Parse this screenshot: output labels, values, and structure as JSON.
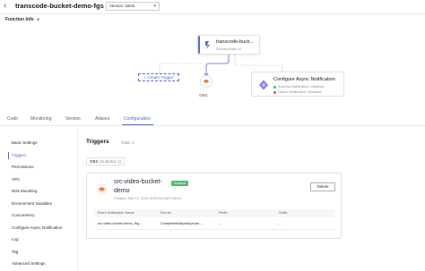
{
  "header": {
    "title": "transcode-bucket-demo-fgs",
    "version_label": "Version: latest"
  },
  "function_info_label": "Function Info",
  "diagram": {
    "function_name": "transcode-buck...",
    "function_sub": "FunctionGraph v2",
    "create_trigger": "+ Create Trigger",
    "obs_label": "OBS",
    "async": {
      "title": "Configure Async Notification",
      "success": "Success Notification: Disabled",
      "failure": "Failure Notification: Disabled"
    }
  },
  "tabs": [
    "Code",
    "Monitoring",
    "Version",
    "Aliases",
    "Configuration"
  ],
  "active_tab": "Configuration",
  "sidebar": {
    "items": [
      "Basic Settings",
      "Triggers",
      "Permissions",
      "VPC",
      "Disk Mounting",
      "Environment Variables",
      "Concurrency",
      "Configure Async Notification",
      "Log",
      "Tag",
      "Advanced Settings"
    ],
    "active": "Triggers"
  },
  "main": {
    "title": "Triggers",
    "total": "Total: 1",
    "section_label": "OBS",
    "section_count": "(Subtotal: 1)",
    "card": {
      "name": "src-video-bucket-demo",
      "status": "Enabled",
      "created": "Created: Mar 27, 2023 14:59:16 GMT+08:00",
      "delete_label": "Delete",
      "columns": [
        "Event Notification Name",
        "Events",
        "Prefix",
        "Suffix"
      ],
      "rows": [
        [
          "src-video-bucket-demo_fhg...",
          "CompleteMultipartUpload ...",
          "--",
          "--"
        ]
      ]
    }
  },
  "colors": {
    "accent": "#526ecc",
    "enabled": "#50b96e",
    "failure": "#e84b4b"
  }
}
